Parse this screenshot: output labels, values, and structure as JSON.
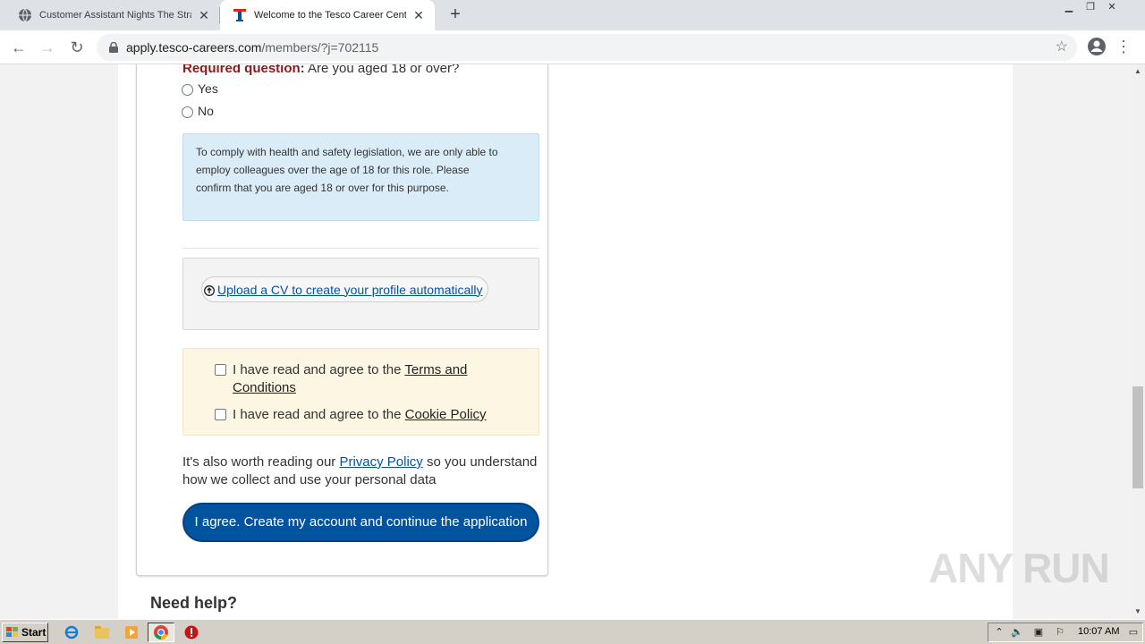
{
  "browser": {
    "tabs": [
      {
        "title": "Customer Assistant Nights The Stran",
        "active": false,
        "icon": "globe-icon"
      },
      {
        "title": "Welcome to the Tesco Career Cente",
        "active": true,
        "icon": "tesco-t-icon"
      }
    ],
    "new_tab_label": "+",
    "url_host": "apply.tesco-careers.com",
    "url_path": "/members/?j=702115"
  },
  "form": {
    "required_prefix": "Required question:",
    "question": "Are you aged 18 or over?",
    "options": [
      "Yes",
      "No"
    ],
    "info_text": "To comply with health and safety legislation, we are only able to employ colleagues over the age of 18 for this role. Please confirm that you are aged 18 or over for this purpose.",
    "upload_label": " Upload a CV to create your profile automatically",
    "terms_prefix": "I have read and agree to the ",
    "terms_link_1": "Terms and",
    "terms_link_2": "Conditions",
    "cookie_prefix": "I have read and agree to the ",
    "cookie_link": "Cookie Policy",
    "privacy_before": "It's also worth reading our ",
    "privacy_link": "Privacy Policy",
    "privacy_after": " so you understand how we collect and use your personal data",
    "cta_label": "I agree. Create my account and continue the application"
  },
  "help_heading": "Need help?",
  "watermark": "ANY RUN",
  "taskbar": {
    "start_label": "Start",
    "clock": "10:07 AM"
  },
  "colors": {
    "brand_blue": "#00539f",
    "required_red": "#8b1a1a",
    "info_bg": "#d9ecf7",
    "terms_bg": "#fcf6e3"
  }
}
